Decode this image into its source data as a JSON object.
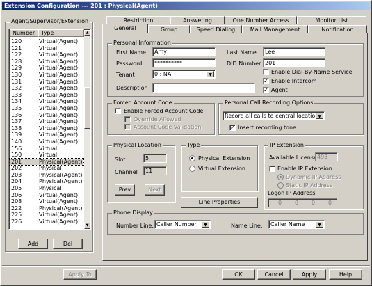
{
  "window": {
    "title": "Extension Configuration --- 201 : Physical(Agent)"
  },
  "left_panel": {
    "group_label": "Agent/Supervisor/Extension",
    "col_number": "Number",
    "col_type": "Type",
    "rows": [
      {
        "number": "120",
        "type": "Virtual(Agent)"
      },
      {
        "number": "121",
        "type": "Virtual"
      },
      {
        "number": "122",
        "type": "Virtual(Agent)"
      },
      {
        "number": "128",
        "type": "Virtual(Agent)"
      },
      {
        "number": "129",
        "type": "Virtual(Agent)"
      },
      {
        "number": "130",
        "type": "Virtual(Agent)"
      },
      {
        "number": "131",
        "type": "Virtual(Agent)"
      },
      {
        "number": "132",
        "type": "Virtual(Agent)"
      },
      {
        "number": "133",
        "type": "Virtual(Agent)"
      },
      {
        "number": "134",
        "type": "Virtual(Agent)"
      },
      {
        "number": "135",
        "type": "Virtual(Agent)"
      },
      {
        "number": "136",
        "type": "Virtual(Agent)"
      },
      {
        "number": "137",
        "type": "Virtual(Agent)"
      },
      {
        "number": "138",
        "type": "Virtual(Agent)"
      },
      {
        "number": "139",
        "type": "Virtual(Agent)"
      },
      {
        "number": "140",
        "type": "Virtual(Agent)"
      },
      {
        "number": "156",
        "type": "Virtual"
      },
      {
        "number": "150",
        "type": "Virtual"
      },
      {
        "number": "201",
        "type": "Physical(Agent)",
        "selected": true
      },
      {
        "number": "202",
        "type": "Physical"
      },
      {
        "number": "203",
        "type": "Physical(Agent)"
      },
      {
        "number": "204",
        "type": "Physical(Agent)"
      },
      {
        "number": "205",
        "type": "Physical"
      },
      {
        "number": "206",
        "type": "Virtual(Agent)"
      },
      {
        "number": "208",
        "type": "Virtual(Agent)"
      },
      {
        "number": "222",
        "type": "Physical(Agent)"
      },
      {
        "number": "225",
        "type": "Virtual(Agent)"
      },
      {
        "number": "226",
        "type": "Virtual(Agent)"
      }
    ],
    "add_label": "Add",
    "del_label": "Del"
  },
  "tabs_back": [
    "Restriction",
    "Answering",
    "One Number Access",
    "Monitor List"
  ],
  "tabs_front": [
    "General",
    "Group",
    "Speed Dialing",
    "Mail Management",
    "Notification"
  ],
  "personal": {
    "group_label": "Personal Information",
    "first_name_label": "First Name",
    "first_name": "Amy",
    "last_name_label": "Last Name",
    "last_name": "Lee",
    "password_label": "Password",
    "password": "**********",
    "did_label": "DID Number",
    "did": "201",
    "tenant_label": "Tenant",
    "tenant": "0 : NA",
    "description_label": "Description",
    "description": "",
    "enable_dial_by_name": "Enable Dial-By-Name Service",
    "enable_intercom": "Enable Intercom",
    "agent": "Agent"
  },
  "forced": {
    "group_label": "Forced Account Code",
    "enable_label": "Enable Forced Account Code",
    "override_label": "Override Allowed",
    "validation_label": "Account Code Validation"
  },
  "recording": {
    "group_label": "Personal Call Recording Options",
    "mode": "Record all calls to central location",
    "insert_tone_label": "Insert recording tone"
  },
  "physical": {
    "group_label": "Physical Location",
    "slot_label": "Slot",
    "slot": "5",
    "channel_label": "Channel",
    "channel": "11",
    "prev_label": "Prev",
    "next_label": "Next"
  },
  "type": {
    "group_label": "Type",
    "physical_label": "Physical Extension",
    "virtual_label": "Virtual Extension",
    "line_properties_label": "Line Properties"
  },
  "ip": {
    "group_label": "IP Extension",
    "available_label": "Available License",
    "available": "493",
    "enable_label": "Enable IP Extension",
    "dynamic_label": "Dynamic IP Address",
    "static_label": "Static IP Address",
    "logon_label": "Logon IP Address",
    "octets": [
      "0",
      "0",
      "0",
      "0"
    ]
  },
  "display": {
    "group_label": "Phone Display",
    "number_line_label": "Number Line:",
    "number_line": "Caller Number",
    "name_line_label": "Name Line:",
    "name_line": "Caller Name"
  },
  "footer": {
    "apply_to": "Apply To",
    "ok": "OK",
    "cancel": "Cancel",
    "apply": "Apply",
    "help": "Help"
  }
}
